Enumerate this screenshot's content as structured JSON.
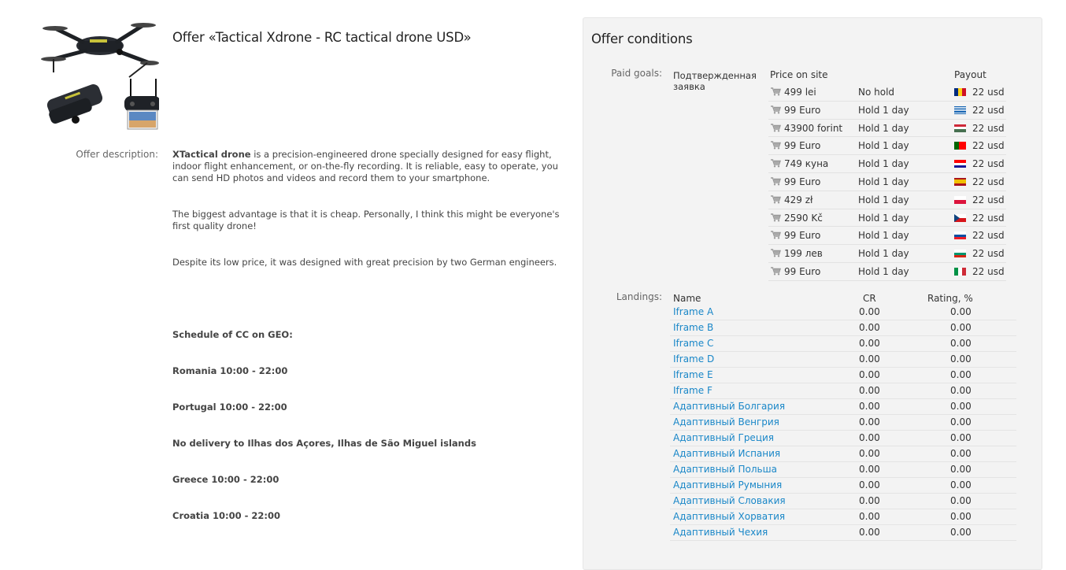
{
  "offer": {
    "title": "Offer «Tactical Xdrone - RC tactical drone USD»",
    "description_label": "Offer description:",
    "description_brand": "XTactical drone",
    "description_p1_rest": " is a precision-engineered drone specially designed for easy flight, indoor flight enhancement, or on-the-fly recording. It is reliable, easy to operate, you can send HD photos and videos and record them to your smartphone.",
    "description_p2": "The biggest advantage is that it is cheap. Personally, I think this might be everyone's first quality drone!",
    "description_p3": "Despite its low price, it was designed with great precision by two German engineers.",
    "schedule": [
      "Schedule of CC on GEO:",
      "Romania 10:00 - 22:00",
      "Portugal 10:00 - 22:00",
      "No delivery to Ilhas dos Açores, Ilhas de São Miguel islands",
      "Greece 10:00 - 22:00",
      "Croatia 10:00 - 22:00"
    ]
  },
  "conditions": {
    "title": "Offer conditions",
    "paid_goals_label": "Paid goals:",
    "goal_name": "Подтвержденная заявка",
    "columns": {
      "price": "Price on site",
      "payout": "Payout"
    },
    "rows": [
      {
        "price": "499 lei",
        "hold": "No hold",
        "flag": "ro",
        "payout": "22 usd"
      },
      {
        "price": "99 Euro",
        "hold": "Hold 1 day",
        "flag": "gr",
        "payout": "22 usd"
      },
      {
        "price": "43900 forint",
        "hold": "Hold 1 day",
        "flag": "hu",
        "payout": "22 usd"
      },
      {
        "price": "99 Euro",
        "hold": "Hold 1 day",
        "flag": "pt",
        "payout": "22 usd"
      },
      {
        "price": "749 куна",
        "hold": "Hold 1 day",
        "flag": "hr",
        "payout": "22 usd"
      },
      {
        "price": "99 Euro",
        "hold": "Hold 1 day",
        "flag": "es",
        "payout": "22 usd"
      },
      {
        "price": "429 zł",
        "hold": "Hold 1 day",
        "flag": "pl",
        "payout": "22 usd"
      },
      {
        "price": "2590 Kč",
        "hold": "Hold 1 day",
        "flag": "cz",
        "payout": "22 usd"
      },
      {
        "price": "99 Euro",
        "hold": "Hold 1 day",
        "flag": "sk",
        "payout": "22 usd"
      },
      {
        "price": "199 лев",
        "hold": "Hold 1 day",
        "flag": "bg",
        "payout": "22 usd"
      },
      {
        "price": "99 Euro",
        "hold": "Hold 1 day",
        "flag": "it",
        "payout": "22 usd"
      }
    ],
    "landings_label": "Landings:",
    "landing_columns": {
      "name": "Name",
      "cr": "CR",
      "rating": "Rating, %"
    },
    "landings": [
      {
        "name": "Iframe A",
        "cr": "0.00",
        "rating": "0.00"
      },
      {
        "name": "Iframe B",
        "cr": "0.00",
        "rating": "0.00"
      },
      {
        "name": "Iframe C",
        "cr": "0.00",
        "rating": "0.00"
      },
      {
        "name": "Iframe D",
        "cr": "0.00",
        "rating": "0.00"
      },
      {
        "name": "Iframe E",
        "cr": "0.00",
        "rating": "0.00"
      },
      {
        "name": "Iframe F",
        "cr": "0.00",
        "rating": "0.00"
      },
      {
        "name": "Адаптивный Болгария",
        "cr": "0.00",
        "rating": "0.00"
      },
      {
        "name": "Адаптивный Венгрия",
        "cr": "0.00",
        "rating": "0.00"
      },
      {
        "name": "Адаптивный Греция",
        "cr": "0.00",
        "rating": "0.00"
      },
      {
        "name": "Адаптивный Испания",
        "cr": "0.00",
        "rating": "0.00"
      },
      {
        "name": "Адаптивный Польша",
        "cr": "0.00",
        "rating": "0.00"
      },
      {
        "name": "Адаптивный Румыния",
        "cr": "0.00",
        "rating": "0.00"
      },
      {
        "name": "Адаптивный Словакия",
        "cr": "0.00",
        "rating": "0.00"
      },
      {
        "name": "Адаптивный Хорватия",
        "cr": "0.00",
        "rating": "0.00"
      },
      {
        "name": "Адаптивный Чехия",
        "cr": "0.00",
        "rating": "0.00"
      }
    ]
  },
  "colors": {
    "link": "#1a87c8",
    "panel_bg": "#f3f3f3",
    "label": "#666666"
  }
}
